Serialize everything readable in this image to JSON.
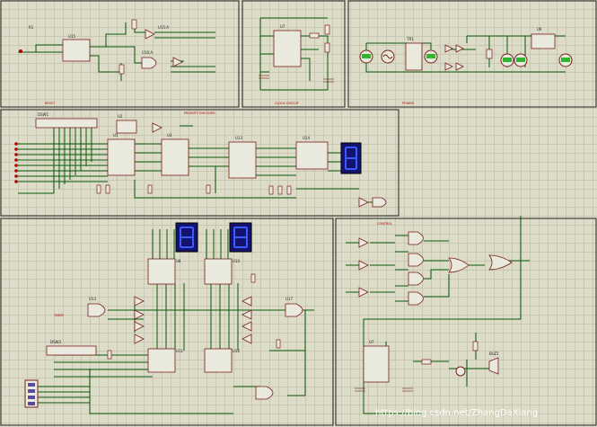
{
  "watermark": "https://blog.csdn.net/ZhangDaXiang",
  "panels": [
    {
      "id": "pulse-generator",
      "label": "RESET"
    },
    {
      "id": "clock-555",
      "label": "CLOCK CIRCUIT"
    },
    {
      "id": "power-supply",
      "label": "POWER"
    },
    {
      "id": "priority-encoder",
      "label": "PRIORITY ENCODER"
    },
    {
      "id": "timer-display",
      "label": "TIMER"
    },
    {
      "id": "control-logic",
      "label": "CONTROL"
    }
  ],
  "components": {
    "power": [
      "TR1",
      "D1",
      "D2",
      "D3",
      "D4",
      "C1",
      "C2",
      "U6"
    ],
    "encoder": [
      "DSW1",
      "U1",
      "U2",
      "U3",
      "U4",
      "U14"
    ],
    "timer": [
      "U8",
      "U9",
      "U10",
      "U11",
      "U12",
      "U13",
      "DSW2"
    ],
    "control": [
      "U15:A",
      "U15:B",
      "U15:C",
      "U16:A",
      "U17",
      "U18",
      "Q1",
      "BUZ1"
    ]
  },
  "colors": {
    "background": "#dcdcc8",
    "wire": "#0a5a0a",
    "component_outline": "#7a1f1f",
    "display_bg": "#14146e",
    "display_segment": "#3b5bff",
    "led_green": "#2fb52f",
    "panel_border": "#222222"
  }
}
